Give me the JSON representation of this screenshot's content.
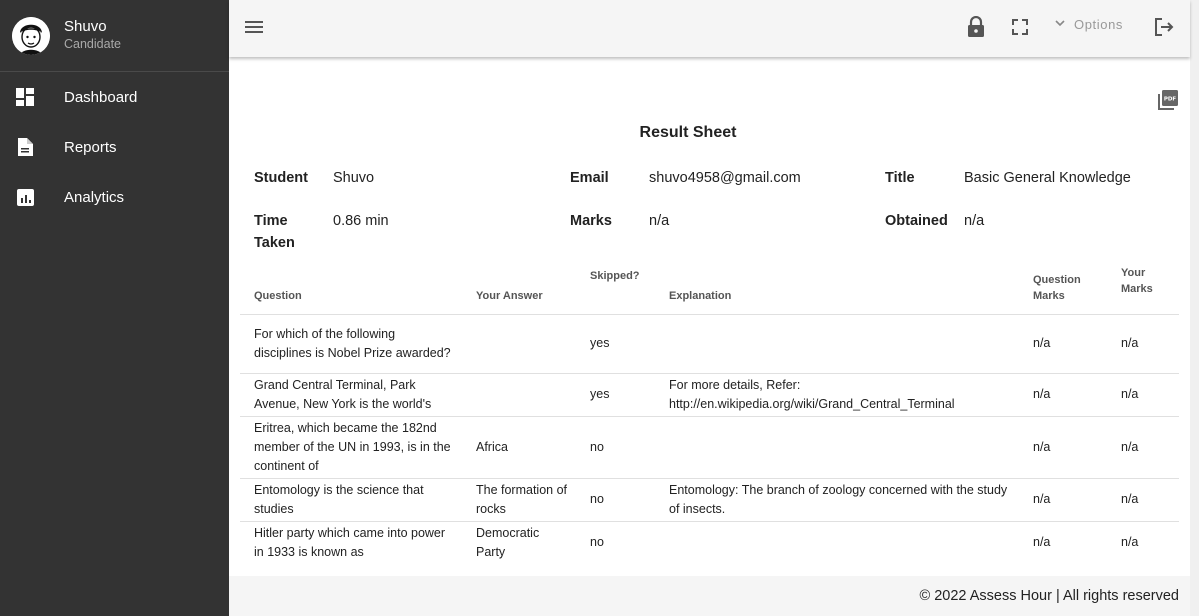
{
  "profile": {
    "name": "Shuvo",
    "role": "Candidate"
  },
  "nav": [
    {
      "label": "Dashboard",
      "icon": "dashboard-icon"
    },
    {
      "label": "Reports",
      "icon": "document-icon"
    },
    {
      "label": "Analytics",
      "icon": "analytics-icon"
    }
  ],
  "topbar": {
    "options_label": "Options"
  },
  "sheet": {
    "title": "Result Sheet",
    "student_label": "Student",
    "student_value": "Shuvo",
    "email_label": "Email",
    "email_value": "shuvo4958@gmail.com",
    "title_label": "Title",
    "title_value": "Basic General Knowledge",
    "time_label": "Time Taken",
    "time_value": "0.86 min",
    "marks_label": "Marks",
    "marks_value": "n/a",
    "obtained_label": "Obtained",
    "obtained_value": "n/a"
  },
  "table": {
    "headers": [
      "Question",
      "Your Answer",
      "Skipped?",
      "Explanation",
      "Question Marks",
      "Your Marks"
    ],
    "rows": [
      [
        "For which of the following disciplines is Nobel Prize awarded?",
        "",
        "yes",
        "",
        "n/a",
        "n/a"
      ],
      [
        "Grand Central Terminal, Park Avenue, New York is the world's",
        "",
        "yes",
        "For more details, Refer: http://en.wikipedia.org/wiki/Grand_Central_Terminal",
        "n/a",
        "n/a"
      ],
      [
        "Eritrea, which became the 182nd member of the UN in 1993, is in the continent of",
        "Africa",
        "no",
        "",
        "n/a",
        "n/a"
      ],
      [
        "Entomology is the science that studies",
        "The formation of rocks",
        "no",
        "Entomology: The branch of zoology concerned with the study of insects.",
        "n/a",
        "n/a"
      ],
      [
        "Hitler party which came into power in 1933 is known as",
        "Democratic Party",
        "no",
        "",
        "n/a",
        "n/a"
      ]
    ]
  },
  "footer": {
    "text": "© 2022 Assess Hour | All rights reserved"
  },
  "colors": {
    "sidebar": "#333333",
    "topbar": "#f5f5f5",
    "content": "#ffffff"
  }
}
